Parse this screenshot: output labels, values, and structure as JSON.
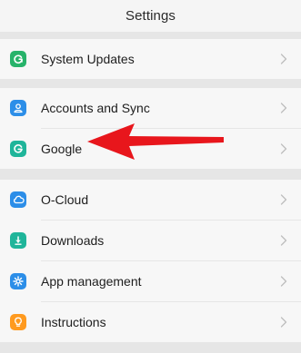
{
  "header": {
    "title": "Settings"
  },
  "groups": [
    {
      "items": [
        {
          "label": "System Updates",
          "icon": "system-updates-icon",
          "color": "#27b36a"
        }
      ]
    },
    {
      "items": [
        {
          "label": "Accounts and Sync",
          "icon": "account-icon",
          "color": "#2c8ee8"
        },
        {
          "label": "Google",
          "icon": "google-icon",
          "color": "#1fb59a"
        }
      ]
    },
    {
      "items": [
        {
          "label": "O-Cloud",
          "icon": "cloud-icon",
          "color": "#2c8ee8"
        },
        {
          "label": "Downloads",
          "icon": "download-icon",
          "color": "#1fb59a"
        },
        {
          "label": "App management",
          "icon": "app-management-icon",
          "color": "#2c8ee8"
        },
        {
          "label": "Instructions",
          "icon": "instructions-icon",
          "color": "#ff9a1f"
        }
      ]
    }
  ],
  "annotation": {
    "arrow_color": "#e8161c",
    "points_to": "Google"
  }
}
